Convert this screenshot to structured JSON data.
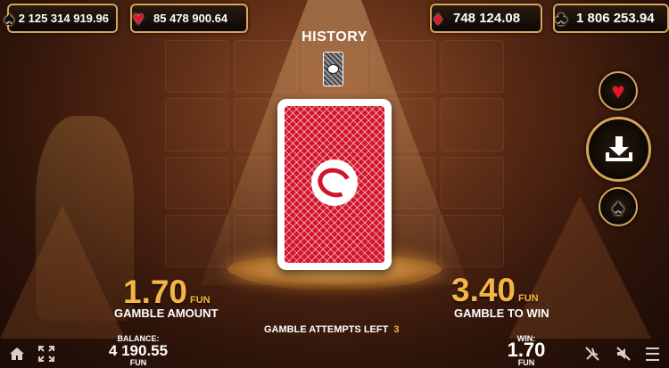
{
  "jackpots": [
    {
      "suit": "spade",
      "value": "2 125 314 919.96"
    },
    {
      "suit": "heart",
      "value": "85 478 900.64"
    },
    {
      "suit": "diamond",
      "value": "748 124.08"
    },
    {
      "suit": "club",
      "value": "1 806 253.94"
    }
  ],
  "history": {
    "title": "HISTORY"
  },
  "gamble": {
    "amount": "1.70",
    "amount_currency": "FUN",
    "amount_label": "GAMBLE AMOUNT",
    "to_win": "3.40",
    "to_win_currency": "FUN",
    "to_win_label": "GAMBLE TO WIN",
    "attempts_label": "GAMBLE ATTEMPTS LEFT",
    "attempts_left": "3"
  },
  "balance": {
    "label": "BALANCE:",
    "value": "4 190.55",
    "currency": "FUN"
  },
  "win": {
    "label": "WIN:",
    "value": "1.70",
    "currency": "FUN"
  },
  "buttons": {
    "red": {
      "icon": "heart-icon"
    },
    "collect": {
      "icon": "download-icon"
    },
    "black": {
      "icon": "spade-icon"
    }
  },
  "colors": {
    "gold": "#f4b545",
    "red": "#e3162a",
    "border_gold": "#d6a55a"
  }
}
